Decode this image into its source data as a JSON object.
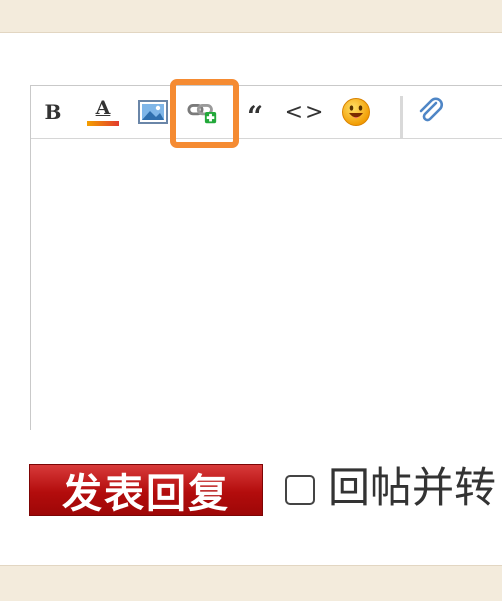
{
  "toolbar": {
    "bold_label": "B",
    "color_label": "A",
    "quote_label": "“",
    "code_label": "<>",
    "icons": [
      "bold-icon",
      "font-color-icon",
      "image-icon",
      "insert-link-icon",
      "quote-icon",
      "code-icon",
      "emoji-icon",
      "attachment-icon"
    ],
    "highlighted_tool": "insert-link-icon"
  },
  "editor": {
    "content": ""
  },
  "actions": {
    "submit_label": "发表回复",
    "checkbox_label": "回帖并转",
    "checkbox_checked": false
  },
  "colors": {
    "highlight": "#f58b32",
    "submit_button": "#b30c0c",
    "page_background": "#f4ede1"
  }
}
